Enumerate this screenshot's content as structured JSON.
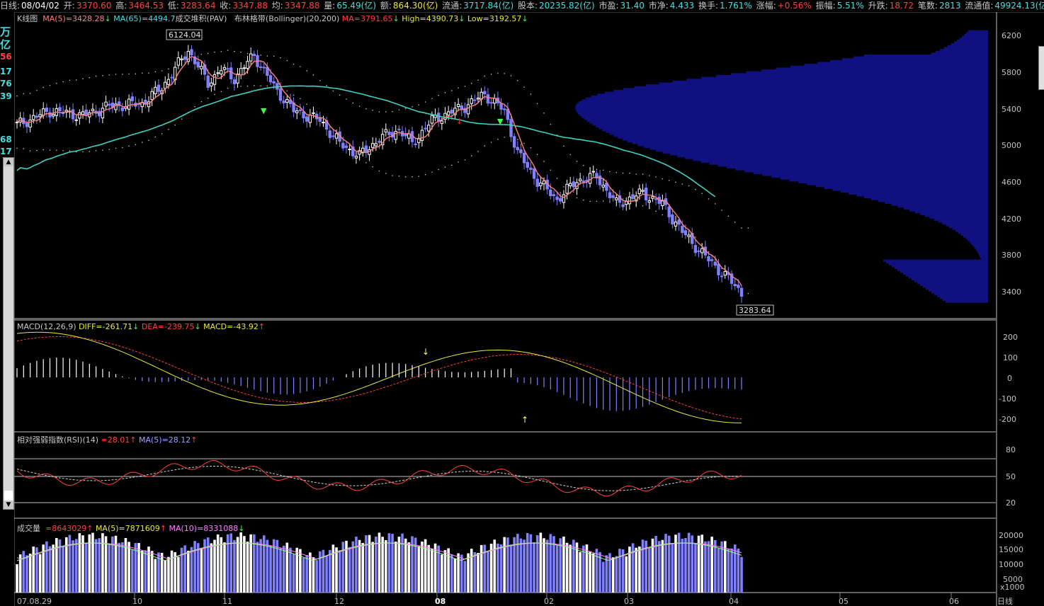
{
  "topbar": {
    "date_label": "日线:",
    "date": "08/04/02",
    "open_label": "开:",
    "open": "3370.60",
    "high_label": "高:",
    "high": "3464.53",
    "low_label": "低:",
    "low": "3283.64",
    "close_label": "收:",
    "close": "3347.88",
    "avg_label": "均:",
    "avg": "3347.88",
    "vol_label": "量:",
    "vol": "65.49(亿)",
    "amt_label": "额:",
    "amt": "864.30(亿)",
    "float_label": "流通:",
    "float": "3717.84(亿)",
    "shares_label": "股本:",
    "shares": "20235.82(亿)",
    "pe_label": "市盈:",
    "pe": "31.40",
    "pb_label": "市净:",
    "pb": "4.433",
    "turnover_label": "换手:",
    "turnover": "1.761%",
    "change_label": "涨幅:",
    "change": "+0.56%",
    "amplitude_label": "振幅:",
    "amplitude": "5.51%",
    "rise_label": "升跌:",
    "rise": "18.72",
    "trades_label": "笔数:",
    "trades": "2813",
    "mcap_label": "流通值:",
    "mcap": "49924.13(亿)"
  },
  "left_strip": {
    "unit1": "万",
    "unit2": "亿",
    "vals": [
      "56",
      "17",
      "76",
      "39",
      "68",
      "17"
    ]
  },
  "kline_panel": {
    "title": "K线图",
    "ma5": "MA(5)=3428.28",
    "ma65": "MA(65)=4494.7",
    "pav": "成交堆积(PAV)",
    "boll": "布林格带(Bollinger)(20,200)",
    "boll_ma": "MA=3791.65",
    "boll_high": "High=4390.73",
    "boll_low": "Low=3192.57",
    "max_label": "6124.04",
    "min_label": "3283.64",
    "yticks": [
      "6200",
      "5800",
      "5400",
      "5000",
      "4600",
      "4200",
      "3800",
      "3400"
    ]
  },
  "macd_panel": {
    "title": "MACD",
    "params": "(12,26,9)",
    "diff": "DIFF=-261.71",
    "dea": "DEA=-239.75",
    "macd": "MACD=-43.92",
    "yticks": [
      "200",
      "100",
      "0",
      "-100",
      "-200"
    ]
  },
  "rsi_panel": {
    "title": "相对强弱指数(RSI)",
    "params": "(14)",
    "rsi": "=28.01",
    "ma5": "MA(5)=28.12",
    "yticks": [
      "80",
      "50",
      "20"
    ]
  },
  "vol_panel": {
    "title": "成交量",
    "vol": "=8643029",
    "ma5": "MA(5)=7871609",
    "ma10": "MA(10)=8331088",
    "yticks": [
      "20000",
      "15000",
      "10000",
      "5000"
    ],
    "unit": "x1000"
  },
  "x_axis": {
    "labels": [
      "07.08.29",
      "10",
      "11",
      "12",
      "08",
      "02",
      "03",
      "04",
      "05",
      "06"
    ],
    "period": "日线"
  },
  "colors": {
    "up": "#ffffff",
    "down": "#8080ff",
    "ma5": "#ff8080",
    "ma65": "#40d0c0",
    "pav": "#101080",
    "grid": "#c0c0c0"
  }
}
